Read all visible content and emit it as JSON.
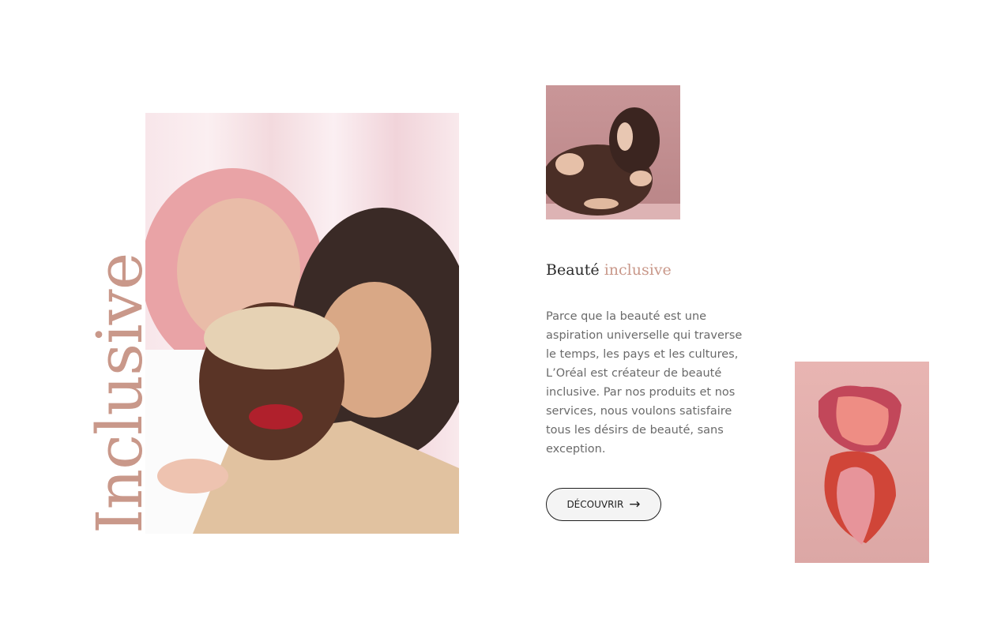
{
  "colors": {
    "accent": "#c9988a",
    "heading": "#2a2a2a",
    "body": "#6a6a6a",
    "button_border": "#1f1f1f"
  },
  "hero": {
    "vertical_word": "Inclusive"
  },
  "section": {
    "title_prefix": "Beauté",
    "title_accent": "inclusive",
    "paragraph": "Parce que la beauté est une aspiration universelle qui traverse le temps, les pays et les cultures, L’Oréal est créateur de beauté inclusive. Par nos produits et nos services, nous voulons satisfaire tous les désirs de beauté, sans exception.",
    "cta_label": "DÉCOUVRIR",
    "cta_icon": "arrow-right-icon"
  }
}
